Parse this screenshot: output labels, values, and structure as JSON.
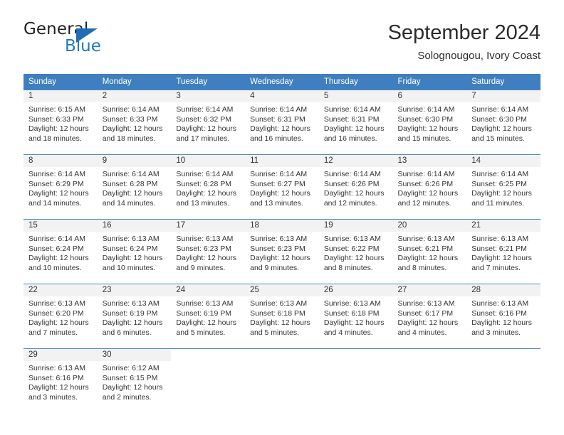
{
  "brand": {
    "name_top": "General",
    "name_bottom": "Blue",
    "accent_color": "#1f7ac4",
    "triangle_color": "#1d6cb5"
  },
  "header": {
    "title": "September 2024",
    "subtitle": "Solognougou, Ivory Coast"
  },
  "calendar": {
    "header_bg": "#3f7fbf",
    "row_border_color": "#4a89c8",
    "daynum_band_bg": "#f2f2f2",
    "weekdays": [
      "Sunday",
      "Monday",
      "Tuesday",
      "Wednesday",
      "Thursday",
      "Friday",
      "Saturday"
    ],
    "labels": {
      "sunrise": "Sunrise:",
      "sunset": "Sunset:",
      "daylight": "Daylight:"
    },
    "weeks": [
      [
        {
          "day": "1",
          "sunrise": "Sunrise: 6:15 AM",
          "sunset": "Sunset: 6:33 PM",
          "daylight_1": "Daylight: 12 hours",
          "daylight_2": "and 18 minutes."
        },
        {
          "day": "2",
          "sunrise": "Sunrise: 6:14 AM",
          "sunset": "Sunset: 6:33 PM",
          "daylight_1": "Daylight: 12 hours",
          "daylight_2": "and 18 minutes."
        },
        {
          "day": "3",
          "sunrise": "Sunrise: 6:14 AM",
          "sunset": "Sunset: 6:32 PM",
          "daylight_1": "Daylight: 12 hours",
          "daylight_2": "and 17 minutes."
        },
        {
          "day": "4",
          "sunrise": "Sunrise: 6:14 AM",
          "sunset": "Sunset: 6:31 PM",
          "daylight_1": "Daylight: 12 hours",
          "daylight_2": "and 16 minutes."
        },
        {
          "day": "5",
          "sunrise": "Sunrise: 6:14 AM",
          "sunset": "Sunset: 6:31 PM",
          "daylight_1": "Daylight: 12 hours",
          "daylight_2": "and 16 minutes."
        },
        {
          "day": "6",
          "sunrise": "Sunrise: 6:14 AM",
          "sunset": "Sunset: 6:30 PM",
          "daylight_1": "Daylight: 12 hours",
          "daylight_2": "and 15 minutes."
        },
        {
          "day": "7",
          "sunrise": "Sunrise: 6:14 AM",
          "sunset": "Sunset: 6:30 PM",
          "daylight_1": "Daylight: 12 hours",
          "daylight_2": "and 15 minutes."
        }
      ],
      [
        {
          "day": "8",
          "sunrise": "Sunrise: 6:14 AM",
          "sunset": "Sunset: 6:29 PM",
          "daylight_1": "Daylight: 12 hours",
          "daylight_2": "and 14 minutes."
        },
        {
          "day": "9",
          "sunrise": "Sunrise: 6:14 AM",
          "sunset": "Sunset: 6:28 PM",
          "daylight_1": "Daylight: 12 hours",
          "daylight_2": "and 14 minutes."
        },
        {
          "day": "10",
          "sunrise": "Sunrise: 6:14 AM",
          "sunset": "Sunset: 6:28 PM",
          "daylight_1": "Daylight: 12 hours",
          "daylight_2": "and 13 minutes."
        },
        {
          "day": "11",
          "sunrise": "Sunrise: 6:14 AM",
          "sunset": "Sunset: 6:27 PM",
          "daylight_1": "Daylight: 12 hours",
          "daylight_2": "and 13 minutes."
        },
        {
          "day": "12",
          "sunrise": "Sunrise: 6:14 AM",
          "sunset": "Sunset: 6:26 PM",
          "daylight_1": "Daylight: 12 hours",
          "daylight_2": "and 12 minutes."
        },
        {
          "day": "13",
          "sunrise": "Sunrise: 6:14 AM",
          "sunset": "Sunset: 6:26 PM",
          "daylight_1": "Daylight: 12 hours",
          "daylight_2": "and 12 minutes."
        },
        {
          "day": "14",
          "sunrise": "Sunrise: 6:14 AM",
          "sunset": "Sunset: 6:25 PM",
          "daylight_1": "Daylight: 12 hours",
          "daylight_2": "and 11 minutes."
        }
      ],
      [
        {
          "day": "15",
          "sunrise": "Sunrise: 6:14 AM",
          "sunset": "Sunset: 6:24 PM",
          "daylight_1": "Daylight: 12 hours",
          "daylight_2": "and 10 minutes."
        },
        {
          "day": "16",
          "sunrise": "Sunrise: 6:13 AM",
          "sunset": "Sunset: 6:24 PM",
          "daylight_1": "Daylight: 12 hours",
          "daylight_2": "and 10 minutes."
        },
        {
          "day": "17",
          "sunrise": "Sunrise: 6:13 AM",
          "sunset": "Sunset: 6:23 PM",
          "daylight_1": "Daylight: 12 hours",
          "daylight_2": "and 9 minutes."
        },
        {
          "day": "18",
          "sunrise": "Sunrise: 6:13 AM",
          "sunset": "Sunset: 6:23 PM",
          "daylight_1": "Daylight: 12 hours",
          "daylight_2": "and 9 minutes."
        },
        {
          "day": "19",
          "sunrise": "Sunrise: 6:13 AM",
          "sunset": "Sunset: 6:22 PM",
          "daylight_1": "Daylight: 12 hours",
          "daylight_2": "and 8 minutes."
        },
        {
          "day": "20",
          "sunrise": "Sunrise: 6:13 AM",
          "sunset": "Sunset: 6:21 PM",
          "daylight_1": "Daylight: 12 hours",
          "daylight_2": "and 8 minutes."
        },
        {
          "day": "21",
          "sunrise": "Sunrise: 6:13 AM",
          "sunset": "Sunset: 6:21 PM",
          "daylight_1": "Daylight: 12 hours",
          "daylight_2": "and 7 minutes."
        }
      ],
      [
        {
          "day": "22",
          "sunrise": "Sunrise: 6:13 AM",
          "sunset": "Sunset: 6:20 PM",
          "daylight_1": "Daylight: 12 hours",
          "daylight_2": "and 7 minutes."
        },
        {
          "day": "23",
          "sunrise": "Sunrise: 6:13 AM",
          "sunset": "Sunset: 6:19 PM",
          "daylight_1": "Daylight: 12 hours",
          "daylight_2": "and 6 minutes."
        },
        {
          "day": "24",
          "sunrise": "Sunrise: 6:13 AM",
          "sunset": "Sunset: 6:19 PM",
          "daylight_1": "Daylight: 12 hours",
          "daylight_2": "and 5 minutes."
        },
        {
          "day": "25",
          "sunrise": "Sunrise: 6:13 AM",
          "sunset": "Sunset: 6:18 PM",
          "daylight_1": "Daylight: 12 hours",
          "daylight_2": "and 5 minutes."
        },
        {
          "day": "26",
          "sunrise": "Sunrise: 6:13 AM",
          "sunset": "Sunset: 6:18 PM",
          "daylight_1": "Daylight: 12 hours",
          "daylight_2": "and 4 minutes."
        },
        {
          "day": "27",
          "sunrise": "Sunrise: 6:13 AM",
          "sunset": "Sunset: 6:17 PM",
          "daylight_1": "Daylight: 12 hours",
          "daylight_2": "and 4 minutes."
        },
        {
          "day": "28",
          "sunrise": "Sunrise: 6:13 AM",
          "sunset": "Sunset: 6:16 PM",
          "daylight_1": "Daylight: 12 hours",
          "daylight_2": "and 3 minutes."
        }
      ],
      [
        {
          "day": "29",
          "sunrise": "Sunrise: 6:13 AM",
          "sunset": "Sunset: 6:16 PM",
          "daylight_1": "Daylight: 12 hours",
          "daylight_2": "and 3 minutes."
        },
        {
          "day": "30",
          "sunrise": "Sunrise: 6:12 AM",
          "sunset": "Sunset: 6:15 PM",
          "daylight_1": "Daylight: 12 hours",
          "daylight_2": "and 2 minutes."
        },
        {
          "day": "",
          "sunrise": "",
          "sunset": "",
          "daylight_1": "",
          "daylight_2": ""
        },
        {
          "day": "",
          "sunrise": "",
          "sunset": "",
          "daylight_1": "",
          "daylight_2": ""
        },
        {
          "day": "",
          "sunrise": "",
          "sunset": "",
          "daylight_1": "",
          "daylight_2": ""
        },
        {
          "day": "",
          "sunrise": "",
          "sunset": "",
          "daylight_1": "",
          "daylight_2": ""
        },
        {
          "day": "",
          "sunrise": "",
          "sunset": "",
          "daylight_1": "",
          "daylight_2": ""
        }
      ]
    ]
  }
}
